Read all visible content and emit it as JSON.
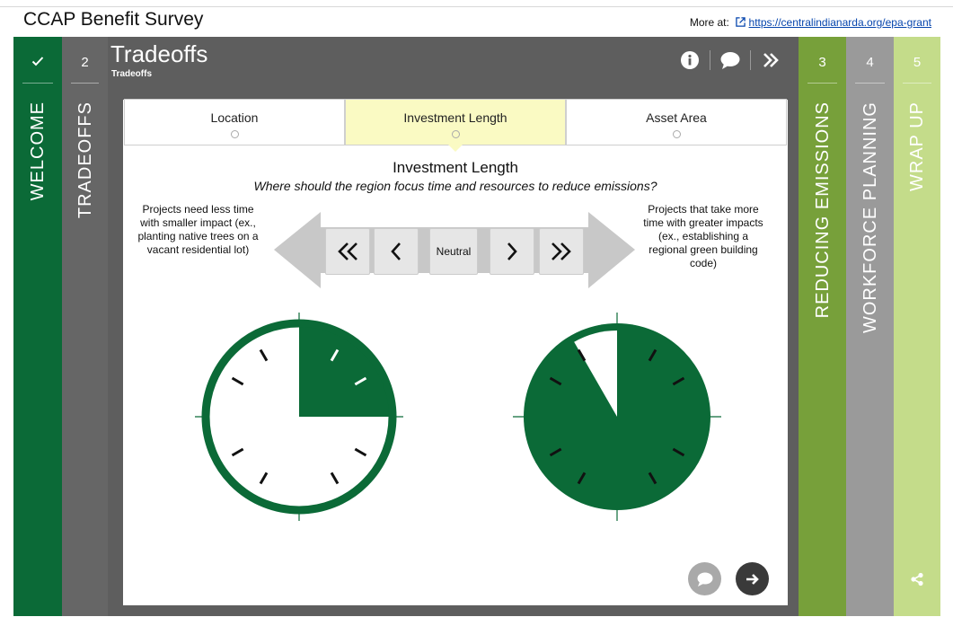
{
  "app": {
    "title": "CCAP Benefit Survey",
    "more_at_label": "More at:",
    "more_at_link": "https://centralindianarda.org/epa-grant"
  },
  "steps": {
    "welcome": {
      "label": "WELCOME",
      "icon": "check-icon"
    },
    "tradeoffs": {
      "number": "2",
      "label": "TRADEOFFS"
    },
    "reducing": {
      "number": "3",
      "label": "REDUCING EMISSIONS"
    },
    "workforce": {
      "number": "4",
      "label": "WORKFORCE PLANNING"
    },
    "wrapup": {
      "number": "5",
      "label": "WRAP UP",
      "icon": "share-icon"
    }
  },
  "panel": {
    "title": "Tradeoffs",
    "subtitle": "Tradeoffs",
    "icons": [
      "info-icon",
      "comment-icon",
      "forward-icon"
    ]
  },
  "tabs": [
    {
      "label": "Location",
      "active": false
    },
    {
      "label": "Investment Length",
      "active": true
    },
    {
      "label": "Asset Area",
      "active": false
    }
  ],
  "question": {
    "title": "Investment Length",
    "subtitle": "Where should the region focus time and resources to reduce emissions?",
    "left_description": "Projects need less time with smaller impact (ex., planting native trees on a vacant residential lot)",
    "right_description": "Projects that take more time with greater impacts (ex., establishing a regional green building code)"
  },
  "scale": {
    "neutral_label": "Neutral",
    "buttons": [
      "strong-left-icon",
      "left-icon",
      "neutral",
      "right-icon",
      "strong-right-icon"
    ]
  },
  "clocks": {
    "left_filled_fraction": 0.25,
    "right_filled_fraction": 0.917
  },
  "colors": {
    "green_dark": "#0b6a37",
    "gray_step": "#666666",
    "panel_bg": "#5e5e5e",
    "green_mid": "#77a03a",
    "gray_light": "#9a9a9a",
    "green_light": "#c4dc8a",
    "tab_active": "#fafac3"
  }
}
